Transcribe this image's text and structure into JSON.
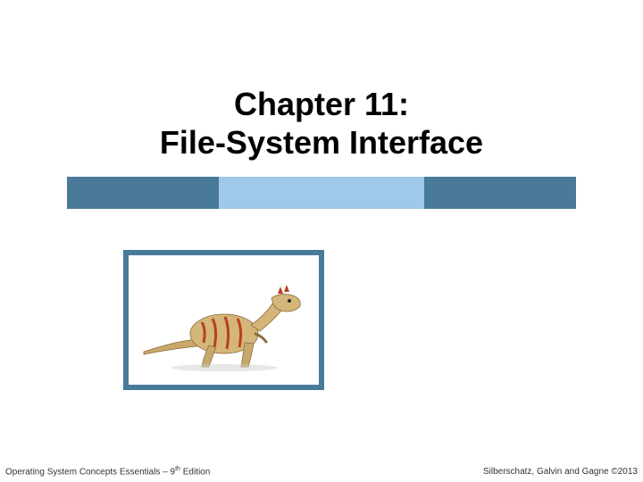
{
  "title": {
    "line1": "Chapter 11:",
    "line2": "File-System Interface"
  },
  "image": {
    "name": "dinosaur-illustration"
  },
  "footer": {
    "left_prefix": "Operating System Concepts Essentials – 9",
    "left_sup": "th",
    "left_suffix": " Edition",
    "right": "Silberschatz, Galvin and Gagne ©2013"
  },
  "colors": {
    "bar_dark": "#4a7a9a",
    "bar_light": "#a0c8e8"
  }
}
